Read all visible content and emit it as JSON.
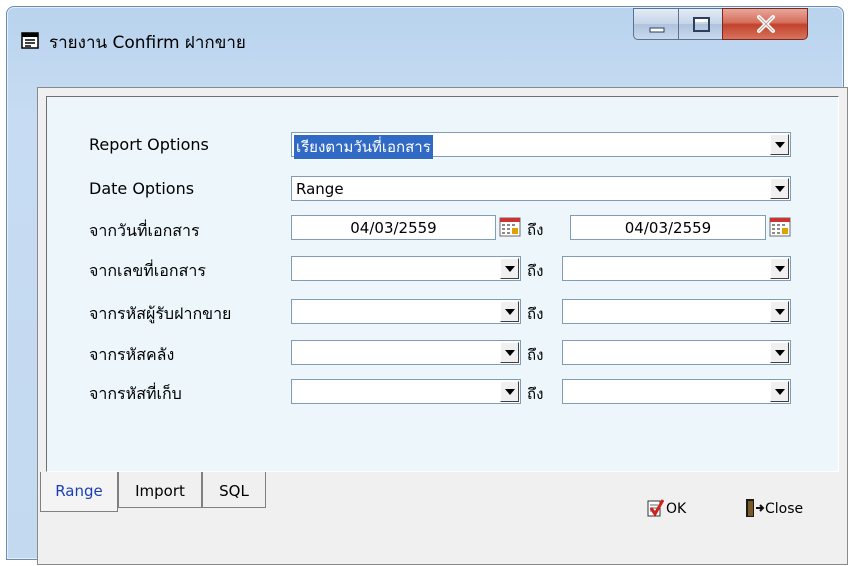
{
  "window": {
    "title": "รายงาน Confirm ฝากขาย",
    "icon": "report-window-icon",
    "controls": {
      "minimize": "minimize-icon",
      "maximize": "maximize-icon",
      "close": "close-icon"
    }
  },
  "form": {
    "report_options": {
      "label": "Report Options",
      "value": "เรียงตามวันที่เอกสาร"
    },
    "date_options": {
      "label": "Date Options",
      "value": "Range"
    },
    "doc_date": {
      "label": "จากวันที่เอกสาร",
      "from": "04/03/2559",
      "to": "04/03/2559"
    },
    "doc_no": {
      "label": "จากเลขที่เอกสาร",
      "from": "",
      "to": ""
    },
    "consignee": {
      "label": "จากรหัสผู้รับฝากขาย",
      "from": "",
      "to": ""
    },
    "warehouse": {
      "label": "จากรหัสคลัง",
      "from": "",
      "to": ""
    },
    "location": {
      "label": "จากรหัสที่เก็บ",
      "from": "",
      "to": ""
    },
    "to_label": "ถึง"
  },
  "tabs": [
    {
      "label": "Range",
      "active": true
    },
    {
      "label": "Import",
      "active": false
    },
    {
      "label": "SQL",
      "active": false
    }
  ],
  "buttons": {
    "ok": "OK",
    "close": "Close"
  },
  "colors": {
    "accent": "#316ac5",
    "active_tab": "#1a3fb5",
    "panel_bg": "#ecf6fb"
  }
}
